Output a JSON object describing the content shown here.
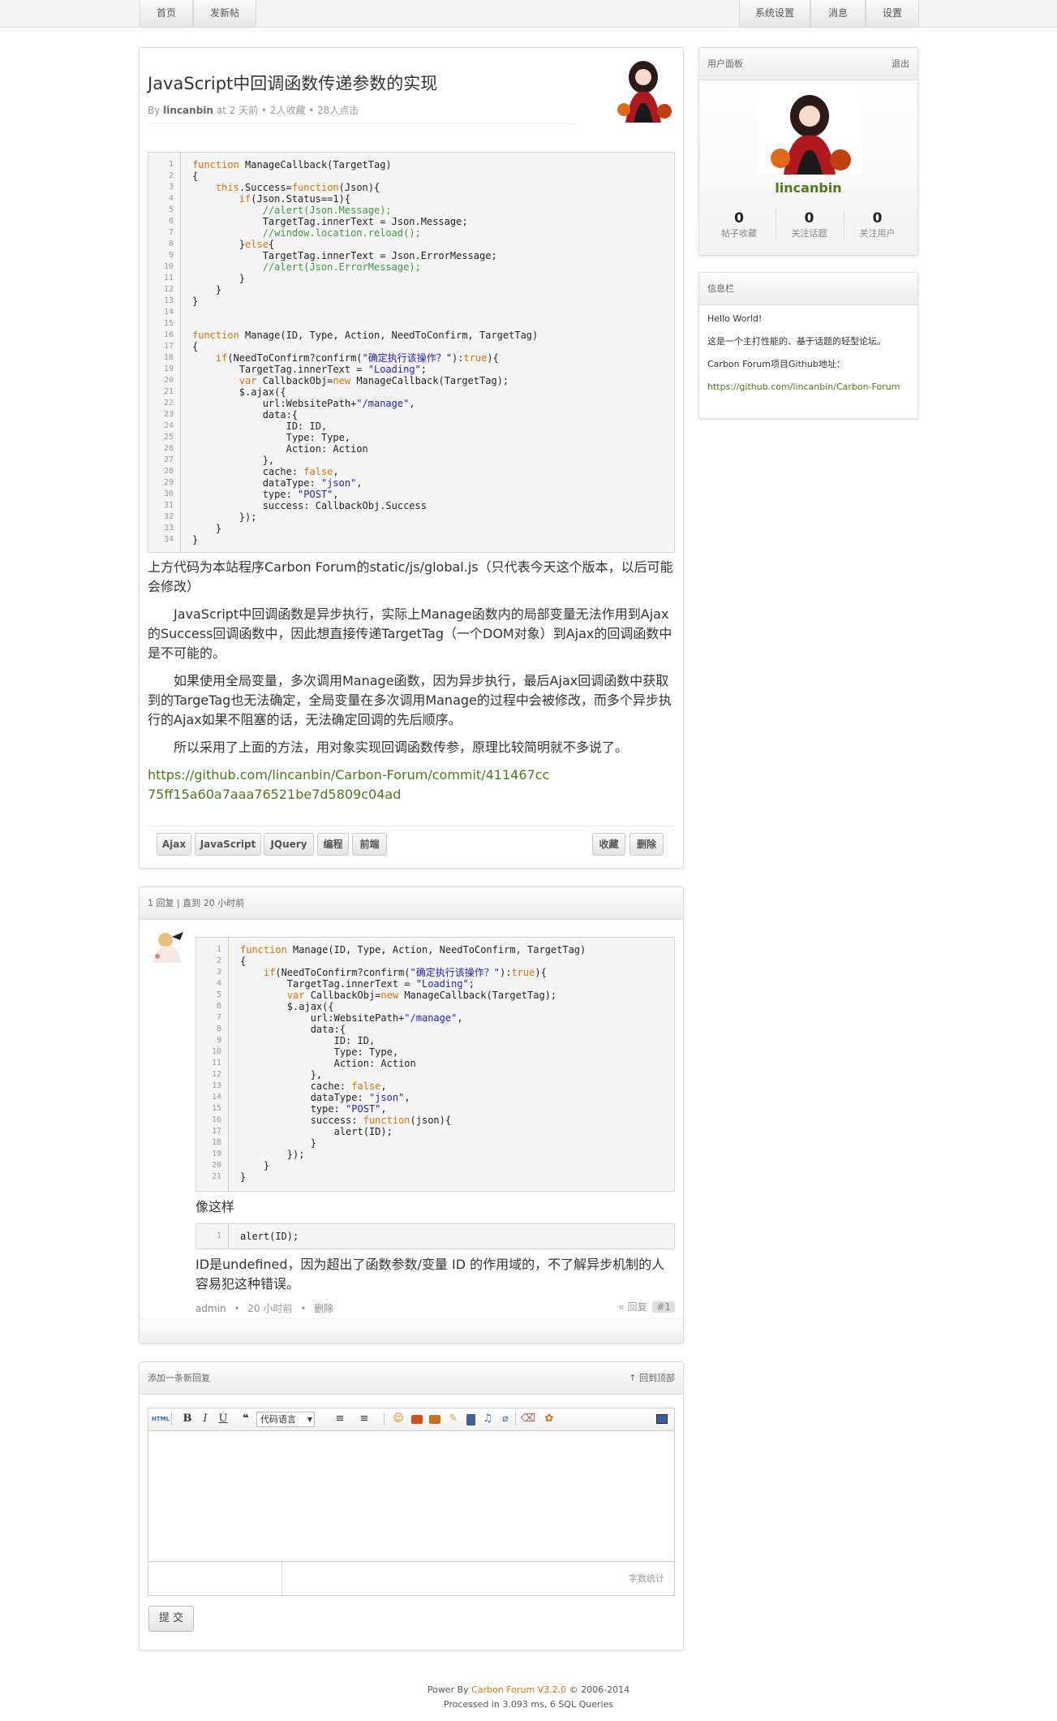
{
  "nav": {
    "left": [
      "首页",
      "发新帖"
    ],
    "right": [
      "系统设置",
      "消息",
      "设置"
    ]
  },
  "topic": {
    "title": "JavaScript中回调函数传递参数的实现",
    "meta_by": "By",
    "author": "lincanbin",
    "meta_rest": "at 2 天前 • 2人收藏 • 28人点击",
    "code": [
      "function ManageCallback(TargetTag)",
      "{",
      "    this.Success=function(Json){",
      "        if(Json.Status==1){",
      "            //alert(Json.Message);",
      "            TargetTag.innerText = Json.Message;",
      "            //window.location.reload();",
      "        }else{",
      "            TargetTag.innerText = Json.ErrorMessage;",
      "            //alert(Json.ErrorMessage);",
      "        }",
      "    }",
      "}",
      "",
      "",
      "function Manage(ID, Type, Action, NeedToConfirm, TargetTag)",
      "{",
      "    if(NeedToConfirm?confirm(\"确定执行该操作？\"):true){",
      "        TargetTag.innerText = \"Loading\";",
      "        var CallbackObj=new ManageCallback(TargetTag);",
      "        $.ajax({",
      "            url:WebsitePath+\"/manage\",",
      "            data:{",
      "                ID: ID,",
      "                Type: Type,",
      "                Action: Action",
      "            },",
      "            cache: false,",
      "            dataType: \"json\",",
      "            type: \"POST\",",
      "            success: CallbackObj.Success",
      "        });",
      "    }",
      "}"
    ],
    "paragraphs": [
      "上方代码为本站程序Carbon Forum的static/js/global.js（只代表今天这个版本，以后可能会修改）",
      "JavaScript中回调函数是异步执行，实际上Manage函数内的局部变量无法作用到Ajax的Success回调函数中，因此想直接传递TargetTag（一个DOM对象）到Ajax的回调函数中是不可能的。",
      "如果使用全局变量，多次调用Manage函数，因为异步执行，最后Ajax回调函数中获取到的TargeTag也无法确定，全局变量在多次调用Manage的过程中会被修改，而多个异步执行的Ajax如果不阻塞的话，无法确定回调的先后顺序。",
      "所以采用了上面的方法，用对象实现回调函数传参，原理比较简明就不多说了。"
    ],
    "link": "https://github.com/lincanbin/Carbon-Forum/commit/411467cc75ff15a60a7aaa76521be7d5809c04ad",
    "tags": [
      "Ajax",
      "JavaScript",
      "JQuery",
      "编程",
      "前端"
    ],
    "actions": [
      "收藏",
      "删除"
    ]
  },
  "replies": {
    "header": "1 回复 | 直到 20 小时前",
    "code": [
      "function Manage(ID, Type, Action, NeedToConfirm, TargetTag)",
      "{",
      "    if(NeedToConfirm?confirm(\"确定执行该操作？\"):true){",
      "        TargetTag.innerText = \"Loading\";",
      "        var CallbackObj=new ManageCallback(TargetTag);",
      "        $.ajax({",
      "            url:WebsitePath+\"/manage\",",
      "            data:{",
      "                ID: ID,",
      "                Type: Type,",
      "                Action: Action",
      "            },",
      "            cache: false,",
      "            dataType: \"json\",",
      "            type: \"POST\",",
      "            success: function(json){",
      "                alert(ID);",
      "            }",
      "        });",
      "    }",
      "}"
    ],
    "text1": "像这样",
    "code2": [
      "alert(ID);"
    ],
    "text2": "ID是undefined，因为超出了函数参数/变量 ID 的作用域的，不了解异步机制的人容易犯这种错误。",
    "author": "admin",
    "time": "20 小时前",
    "delete": "删除",
    "reply": "« 回复",
    "floor": "#1"
  },
  "new_reply": {
    "header": "添加一条新回复",
    "back_top": "↑ 回到顶部",
    "toolbar": {
      "html": "HTML",
      "bold": "B",
      "italic": "I",
      "underline": "U",
      "quote": "❝",
      "lang_select": "代码语言",
      "ol": "≡",
      "ul": "≡"
    },
    "word_count": "字数统计",
    "submit": "提 交"
  },
  "sidebar": {
    "panel_title": "用户面板",
    "logout": "退出",
    "username": "lincanbin",
    "stats": [
      {
        "num": "0",
        "label": "帖子收藏"
      },
      {
        "num": "0",
        "label": "关注话题"
      },
      {
        "num": "0",
        "label": "关注用户"
      }
    ],
    "info_title": "信息栏",
    "info_lines": [
      "Hello World!",
      "这是一个主打性能的、基于话题的轻型论坛。",
      "Carbon Forum项目Github地址："
    ],
    "info_link": "https://github.com/lincanbin/Carbon-Forum"
  },
  "footer": {
    "line1_pre": "Power By",
    "line1_link": "Carbon Forum V3.2.0",
    "line1_post": "© 2006-2014",
    "line2": "Processed in 3.093 ms, 6 SQL Queries"
  },
  "colors": {
    "link_green": "#4a7a1a",
    "accent_orange": "#e07000",
    "keyword_red": "#d14"
  }
}
